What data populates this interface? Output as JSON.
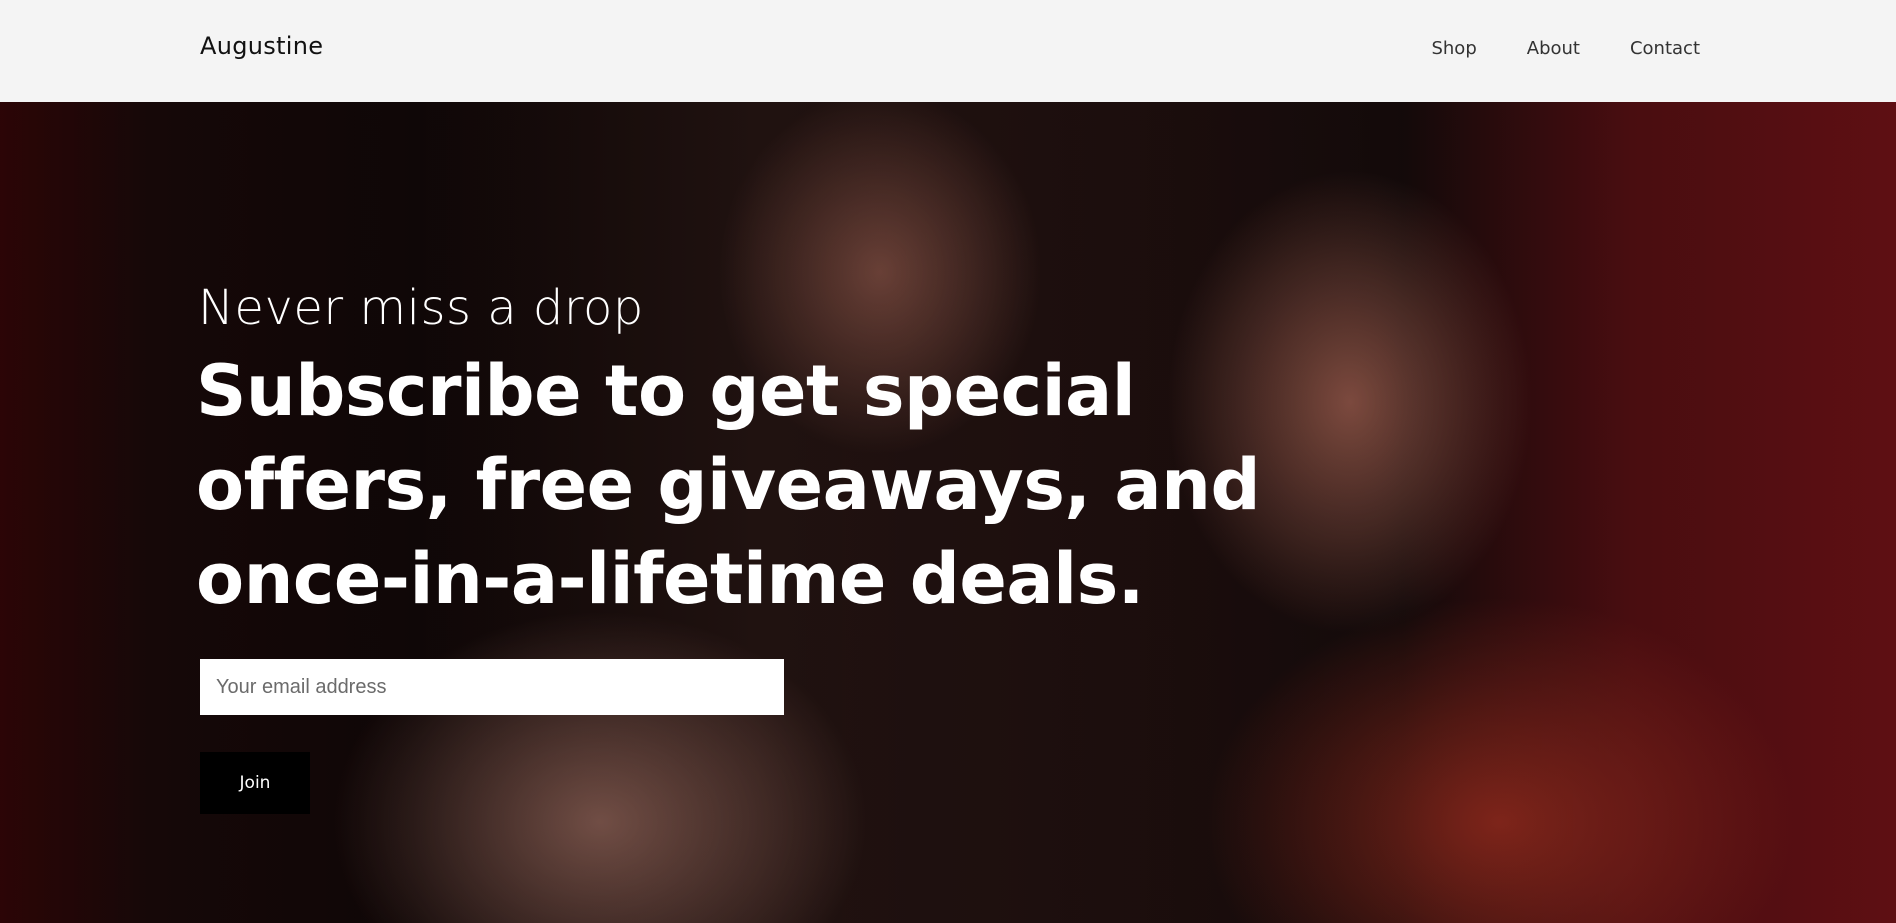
{
  "header": {
    "brand": "Augustine",
    "nav": [
      "Shop",
      "About",
      "Contact"
    ]
  },
  "hero": {
    "eyebrow": "Never miss a drop",
    "headline_lines": [
      "Subscribe to get special",
      "offers, free giveaways, and",
      "once-in-a-lifetime deals."
    ],
    "email": {
      "value": "",
      "placeholder": "Your email address"
    },
    "join_label": "Join"
  }
}
